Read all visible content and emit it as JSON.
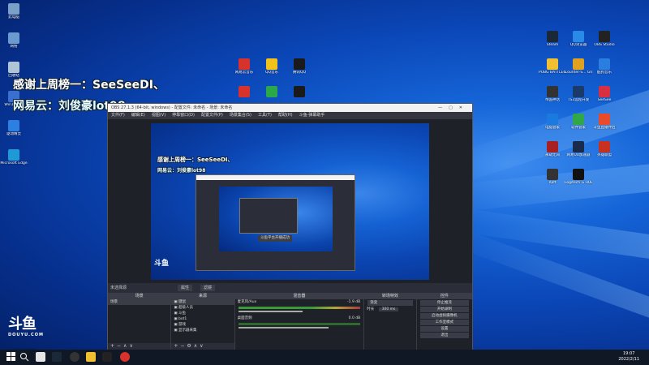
{
  "overlay": {
    "line1": "感谢上周榜一：SeeSeeDI、",
    "line2": "网易云：刘俊豪lot98"
  },
  "desktop_left": [
    {
      "label": "此电脑",
      "color": "#7aa0c8"
    },
    {
      "label": "网络",
      "color": "#6a9ad0"
    },
    {
      "label": "回收站",
      "color": "#b0c4d8"
    },
    {
      "label": "Win10激活",
      "color": "#3a6fd0"
    },
    {
      "label": "驱动精灵",
      "color": "#2d80e0"
    },
    {
      "label": "Microsoft Edge",
      "color": "#1f9ad6"
    }
  ],
  "desktop_mid": [
    {
      "label": "网易云音乐",
      "color": "#d8322c"
    },
    {
      "label": "QQ音乐",
      "color": "#f2c21a"
    },
    {
      "label": "腾讯QQ",
      "color": "#1a1a1a"
    },
    {
      "label": "",
      "color": "#d8322c"
    },
    {
      "label": "",
      "color": "#2aa84a"
    },
    {
      "label": "",
      "color": "#1a1a1a"
    }
  ],
  "desktop_right": [
    {
      "label": "Steam",
      "color": "#1b2838"
    },
    {
      "label": "QQ浏览器",
      "color": "#2a8ae8"
    },
    {
      "label": "OBS Studio",
      "color": "#222"
    },
    {
      "label": "PUBG BATTLEGR...",
      "color": "#f0c030"
    },
    {
      "label": "Counter-S... Global Off...",
      "color": "#e0a020"
    },
    {
      "label": "酷狗音乐",
      "color": "#2a7ee0"
    },
    {
      "label": "帝国神话",
      "color": "#333"
    },
    {
      "label": "TS3远程开发",
      "color": "#1a3a6a"
    },
    {
      "label": "SeeSee",
      "color": "#d83040"
    },
    {
      "label": "电脑管家",
      "color": "#1a7ae0"
    },
    {
      "label": "软件管家",
      "color": "#30a848"
    },
    {
      "label": "斗鱼直播伴侣",
      "color": "#e84a2a"
    },
    {
      "label": "永劫无间",
      "color": "#a82020"
    },
    {
      "label": "网易UU加速器",
      "color": "#1a2a4a"
    },
    {
      "label": "英雄联盟",
      "color": "#c83020"
    },
    {
      "label": "Raft",
      "color": "#333"
    },
    {
      "label": "Logitech G HUB",
      "color": "#111"
    }
  ],
  "obs": {
    "title": "OBS 27.1.3 (64-bit, windows) - 配置文件: 未命名 - 场景: 未命名",
    "menu": [
      "文件(F)",
      "编辑(E)",
      "视图(V)",
      "停靠窗口(D)",
      "配置文件(P)",
      "场景集合(S)",
      "工具(T)",
      "帮助(H)",
      "斗鱼-弹幕助手"
    ],
    "inner_toast": "斗鱼平台开播成功",
    "scene_label": "未选择源",
    "props_label": "属性",
    "filters_label": "滤镜",
    "docks": {
      "scenes": {
        "title": "场景",
        "items": [
          "场景"
        ]
      },
      "sources": {
        "title": "来源",
        "items": [
          "键鼠",
          "超级人员",
          "斗鱼",
          "bot1",
          "游戏",
          "显示器采集"
        ]
      },
      "mixer": {
        "title": "混音器",
        "channels": [
          {
            "name": "麦克风/Aux",
            "db": "-1.9 dB"
          },
          {
            "name": "桌面音频",
            "db": "0.0 dB"
          }
        ]
      },
      "transitions": {
        "title": "转场特效",
        "type": "渐变",
        "duration_label": "时长",
        "duration": "300 ms"
      },
      "controls": {
        "title": "控件",
        "buttons": [
          "停止推流",
          "开始录制",
          "启动虚拟摄像机",
          "工作室模式",
          "设置",
          "退出"
        ]
      }
    },
    "status": "LIVE: 00:15:34  REC: 00:00:00  CPU: 4.5%, 60.00 fps"
  },
  "douyu": {
    "mark": "斗鱼",
    "sub": "DOUYU.COM",
    "viewers": "289757"
  },
  "taskbar": {
    "clock_time": "19:07",
    "clock_date": "2022/2/11"
  }
}
